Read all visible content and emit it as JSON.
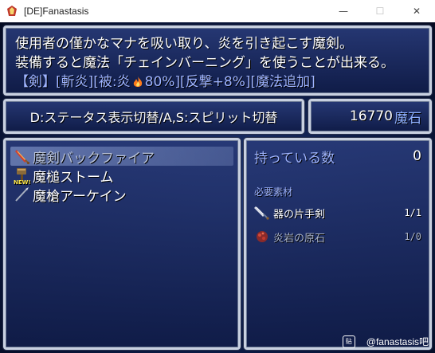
{
  "window": {
    "title": "[DE]Fanastasis",
    "minimize_glyph": "—",
    "maximize_glyph": "☐",
    "close_glyph": "✕"
  },
  "description": {
    "line1": "使用者の僅かなマナを吸い取り、炎を引き起こす魔剣。",
    "line2": "装備すると魔法「チェインバーニング」を使うことが出来る。",
    "tags_before_icon": "【剣】[斬炎][被:炎",
    "tags_after_icon": "80%][反撃+8%][魔法追加]"
  },
  "hint": {
    "text": "D:ステータス表示切替/A,S:スピリット切替"
  },
  "money": {
    "amount": "16770",
    "unit": "魔石"
  },
  "item_list": [
    {
      "name": "魔剣バックファイア",
      "icon": "flame-sword-icon",
      "selected": true,
      "is_new": false
    },
    {
      "name": "魔槌ストーム",
      "icon": "hammer-icon",
      "selected": false,
      "is_new": true,
      "new_label": "NEW!"
    },
    {
      "name": "魔槍アーケイン",
      "icon": "spear-icon",
      "selected": false,
      "is_new": false
    }
  ],
  "detail": {
    "owned_label": "持っている数",
    "owned_count": "0",
    "required_header": "必要素材",
    "materials": [
      {
        "name": "器の片手剣",
        "count": "1/1",
        "icon": "sword-icon",
        "sufficient": true
      },
      {
        "name": "炎岩の原石",
        "count": "1/0",
        "icon": "ore-icon",
        "sufficient": false
      }
    ]
  },
  "watermark": {
    "text": "@fanastasis吧",
    "logo_text": "贴"
  },
  "colors": {
    "window_bg_top": "#283a78",
    "window_bg_bottom": "#101c48",
    "label_blue": "#9fb4ff",
    "border": "#c8d0e0"
  }
}
